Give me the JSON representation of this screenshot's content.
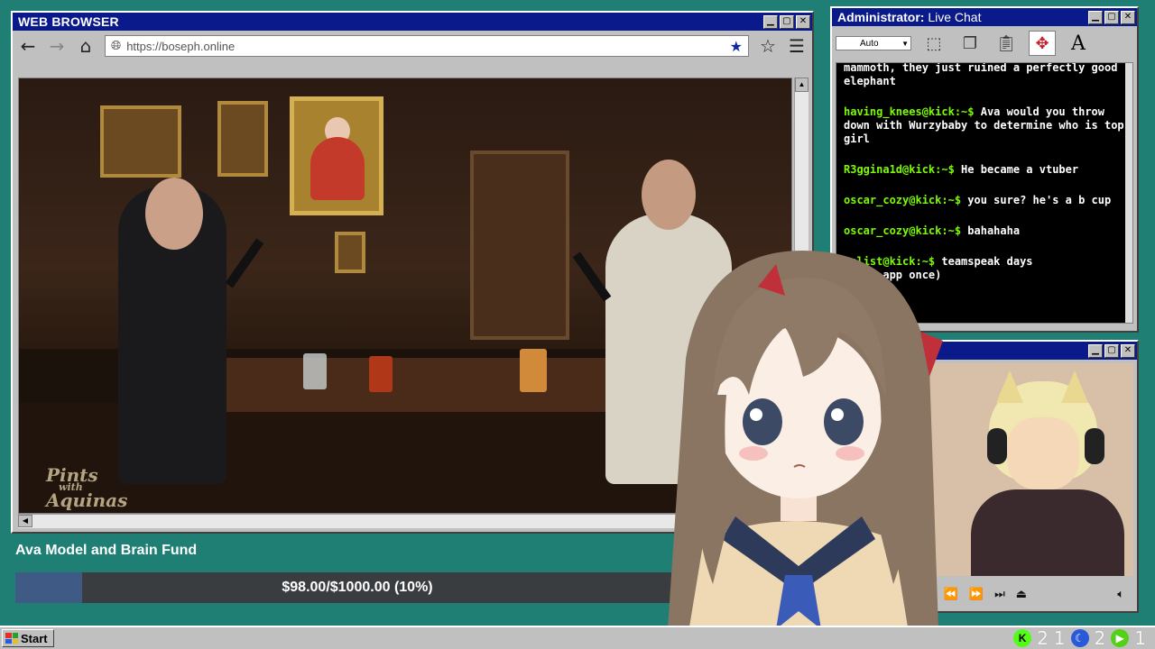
{
  "browser": {
    "title": "WEB BROWSER",
    "url": "https://boseph.online",
    "controls": {
      "minimize": "_",
      "maximize": "□",
      "close": "✕"
    }
  },
  "video": {
    "watermark_line1": "Pints",
    "watermark_line2": "with",
    "watermark_line3": "Aquinas"
  },
  "fund": {
    "title": "Ava Model and Brain Fund",
    "progress_text": "$98.00/$1000.00 (10%)",
    "progress_fraction": 0.098,
    "fill_color": "#3e5a85"
  },
  "chat": {
    "title_bold": "Administrator:",
    "title_rest": " Live Chat",
    "zoom_select": "Auto",
    "messages": [
      {
        "user": "",
        "text": "mammoth, they just ruined a perfectly good elephant"
      },
      {
        "user": "having_knees@kick:~$",
        "text": " Ava would you throw down with Wurzybaby to determine who is top girl"
      },
      {
        "user": "R3ggina1d@kick:~$",
        "text": " He became a vtuber"
      },
      {
        "user": "oscar_cozy@kick:~$",
        "text": " you sure? he's a b cup"
      },
      {
        "user": "oscar_cozy@kick:~$",
        "text": " bahahaha"
      },
      {
        "user": "nalist@kick:~$",
        "text": " teamspeak days"
      },
      {
        "user": "",
        "text": "d the app once)"
      }
    ]
  },
  "taskbar": {
    "start_label": "Start",
    "tray": [
      {
        "icon": "kick-icon",
        "count": "2"
      },
      {
        "icon": "count-1",
        "count": "1"
      },
      {
        "icon": "moon-icon",
        "count": "2"
      },
      {
        "icon": "play-icon",
        "count": "1"
      }
    ]
  },
  "colors": {
    "desktop": "#1f7f74",
    "titlebar": "#0a1a8a",
    "chat_user": "#7cfc00"
  }
}
